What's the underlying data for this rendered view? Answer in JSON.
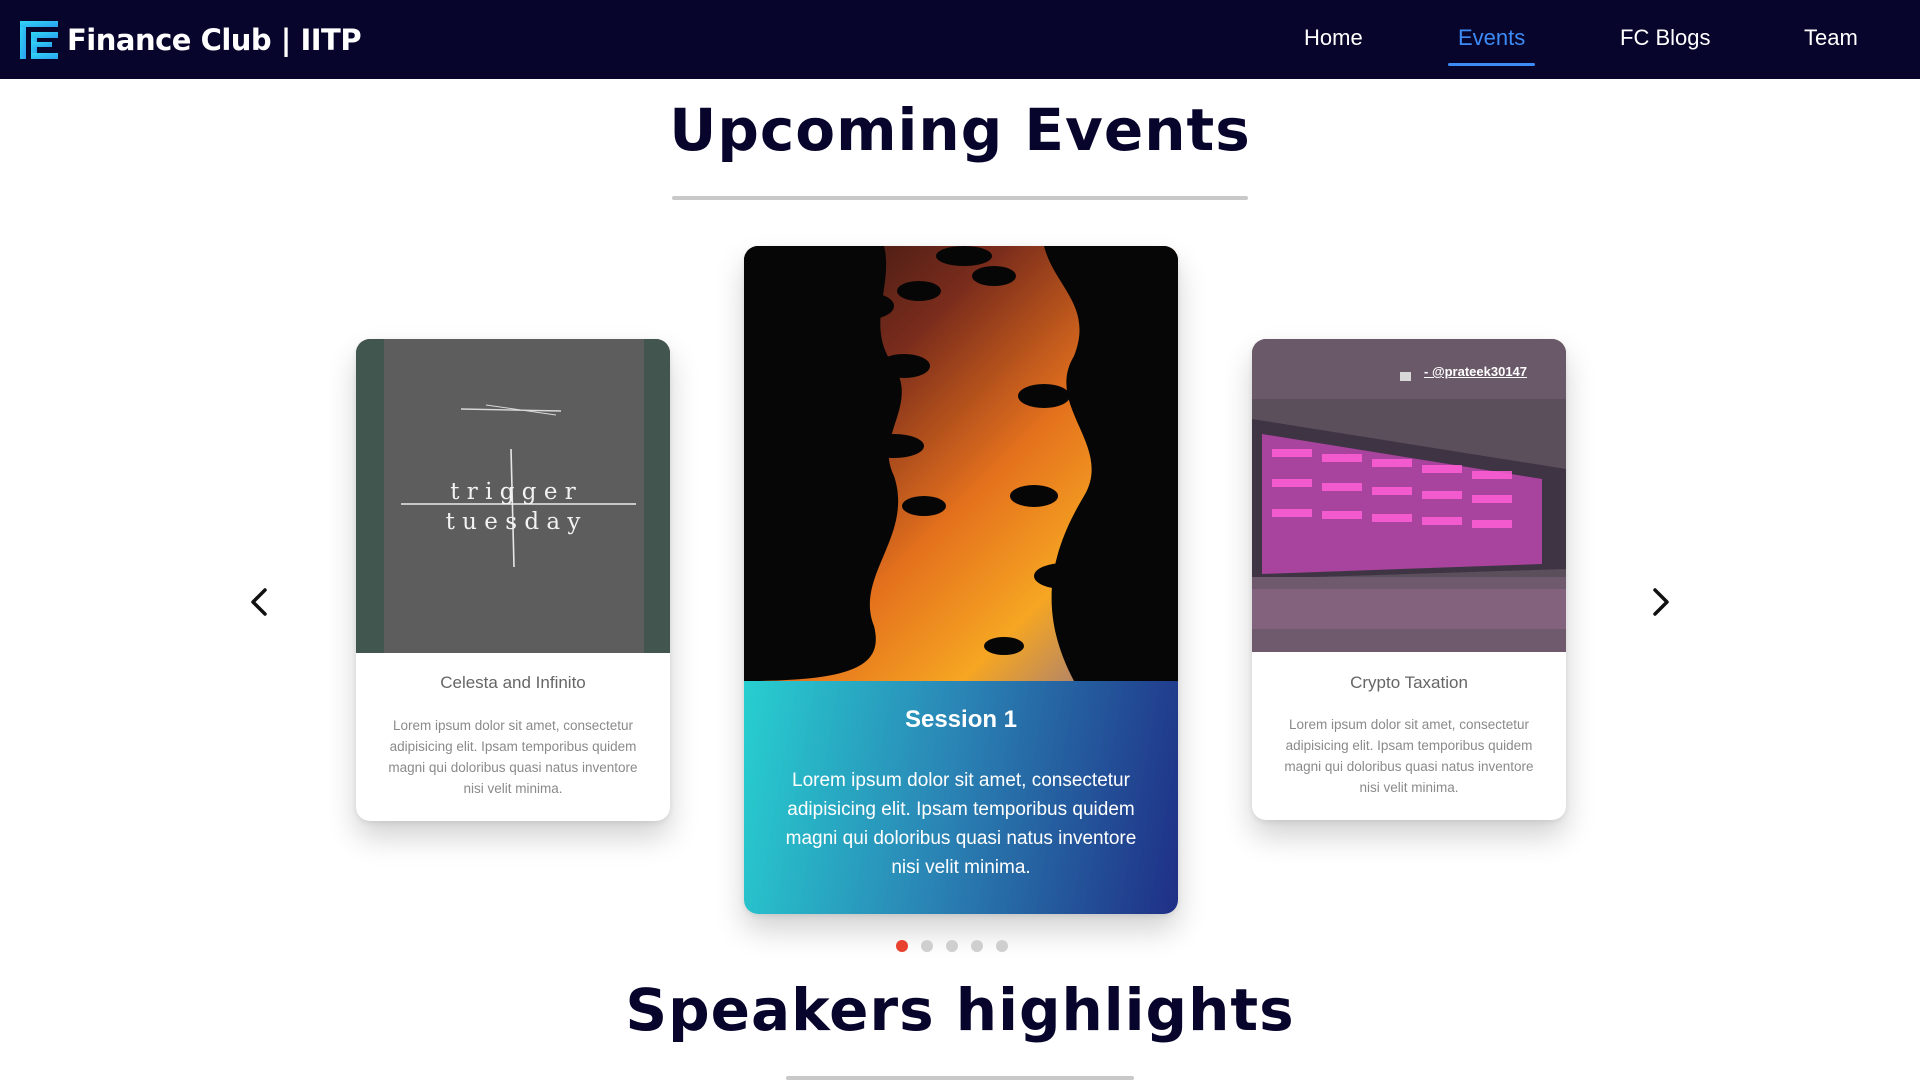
{
  "navbar": {
    "brand": "Finance Club | IITP",
    "links": [
      "Home",
      "Events",
      "FC Blogs",
      "Team"
    ],
    "active": "Events"
  },
  "sections": {
    "upcoming_title": "Upcoming Events",
    "speakers_title": "Speakers highlights"
  },
  "carousel": {
    "cards": [
      {
        "title": "Celesta and Infinito",
        "text": "Lorem ipsum dolor sit amet, consectetur adipisicing elit. Ipsam temporibus quidem magni qui doloribus quasi natus inventore nisi velit minima.",
        "image_text": [
          "t r i g g e r",
          "t u e s d a y"
        ]
      },
      {
        "title": "Session 1",
        "text": "Lorem ipsum dolor sit amet, consectetur adipisicing elit. Ipsam temporibus quidem magni qui doloribus quasi natus inventore nisi velit minima."
      },
      {
        "title": "Crypto Taxation",
        "text": "Lorem ipsum dolor sit amet, consectetur adipisicing elit. Ipsam temporibus quidem magni qui doloribus quasi natus inventore nisi velit minima.",
        "image_credit": "- @prateek30147"
      }
    ],
    "dot_count": 5,
    "active_dot": 1
  },
  "icons": {
    "prev": "chevron-left-icon",
    "next": "chevron-right-icon",
    "logo": "finance-club-logo-icon",
    "camera": "camera-icon"
  },
  "colors": {
    "nav_bg": "#07052b",
    "accent": "#3d8bf5",
    "active_dot": "#e8412e",
    "title": "#07052b",
    "card_gradient_start": "#27cfd0",
    "card_gradient_end": "#1f2f86"
  }
}
